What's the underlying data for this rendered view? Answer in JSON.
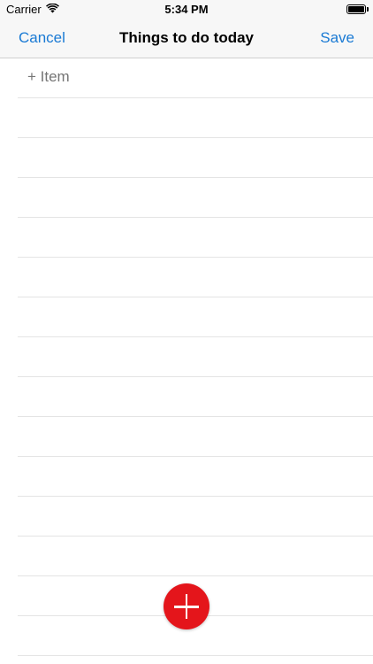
{
  "status_bar": {
    "carrier": "Carrier",
    "time": "5:34 PM",
    "wifi_icon": "wifi-icon",
    "battery_icon": "battery-icon"
  },
  "nav": {
    "cancel_label": "Cancel",
    "title": "Things to do today",
    "save_label": "Save"
  },
  "list": {
    "new_item_placeholder": "+ Item",
    "empty_rows": 15
  },
  "fab": {
    "icon": "plus-icon",
    "color": "#e4151b"
  },
  "colors": {
    "accent": "#1a7ad4",
    "placeholder": "#c4c4c9",
    "separator": "#e4e4e4"
  }
}
